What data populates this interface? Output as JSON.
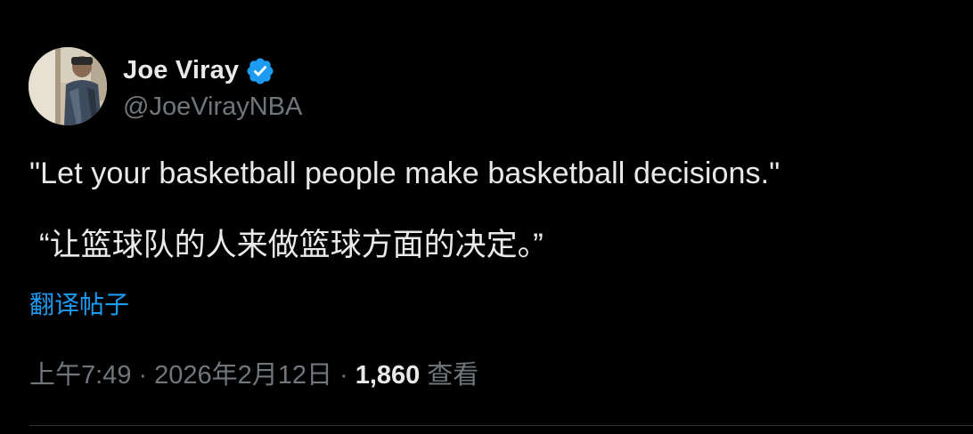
{
  "author": {
    "display_name": "Joe Viray",
    "handle": "@JoeVirayNBA",
    "verified": true,
    "verified_color": "#1d9bf0",
    "avatar_icon": "profile-photo"
  },
  "tweet": {
    "text_en": "\"Let your basketball people make basketball decisions.\"",
    "text_cn": "“让篮球队的人来做篮球方面的决定。”",
    "translate_label": "翻译帖子"
  },
  "meta": {
    "time": "上午7:49",
    "separator": "·",
    "date": "2026年2月12日",
    "views_count": "1,860",
    "views_label": "查看"
  },
  "colors": {
    "background": "#000000",
    "text_primary": "#e7e9ea",
    "text_secondary": "#71767b",
    "link": "#1d9bf0",
    "divider": "#2f3336"
  }
}
